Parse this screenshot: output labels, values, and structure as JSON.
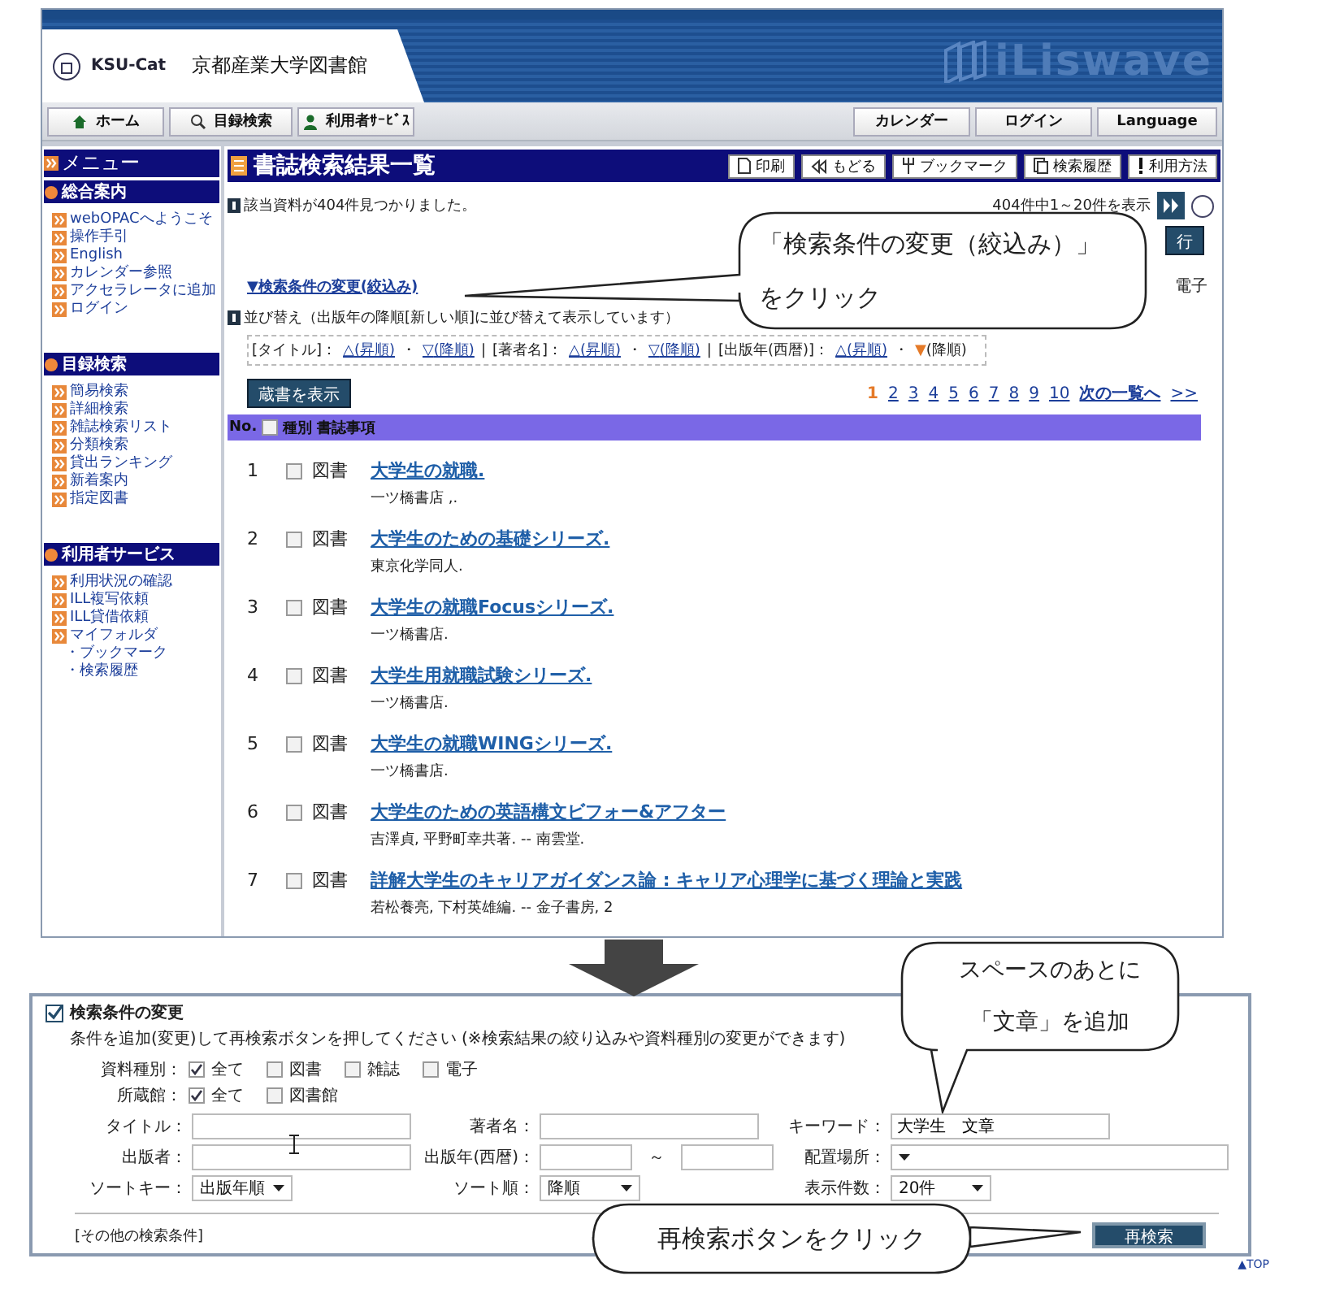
{
  "header": {
    "logo_text": "KSU-Cat",
    "library_name": "京都産業大学図書館",
    "brand": "iLiswave"
  },
  "nav": {
    "left": [
      "ホーム",
      "目録検索",
      "利用者ｻｰﾋﾞｽ"
    ],
    "right": [
      "カレンダー",
      "ログイン",
      "Language"
    ]
  },
  "sidebar": {
    "title": "メニュー",
    "sections": [
      {
        "title": "総合案内",
        "items": [
          {
            "label": "webOPACへようこそ"
          },
          {
            "label": "操作手引"
          },
          {
            "label": "English"
          },
          {
            "label": "カレンダー参照"
          },
          {
            "label": "アクセラレータに追加"
          },
          {
            "label": "ログイン"
          }
        ]
      },
      {
        "title": "目録検索",
        "items": [
          {
            "label": "簡易検索"
          },
          {
            "label": "詳細検索"
          },
          {
            "label": "雑誌検索リスト"
          },
          {
            "label": "分類検索"
          },
          {
            "label": "貸出ランキング"
          },
          {
            "label": "新着案内"
          },
          {
            "label": "指定図書"
          }
        ]
      },
      {
        "title": "利用者サービス",
        "items": [
          {
            "label": "利用状況の確認"
          },
          {
            "label": "ILL複写依頼"
          },
          {
            "label": "ILL貸借依頼"
          },
          {
            "label": "マイフォルダ",
            "children": [
              {
                "label": "・ブックマーク"
              },
              {
                "label": "・検索履歴"
              }
            ]
          }
        ]
      }
    ]
  },
  "main": {
    "title": "書誌検索結果一覧",
    "toolbar": [
      "印刷",
      "もどる",
      "ブックマーク",
      "検索履歴",
      "利用方法"
    ],
    "result_message": "該当資料が404件見つかりました。",
    "range": "404件中1～20件を表示",
    "covered_button": "行",
    "covered_label": "電子",
    "refine_link": "▼検索条件の変更(絞込み)",
    "sort_note": "並び替え（出版年の降順[新しい順]に並び替えて表示しています）",
    "option_separator": "・",
    "group_separator": "|",
    "sort_groups": [
      {
        "label": "[タイトル]：",
        "options": [
          {
            "arrow": "△",
            "label": "(昇順)",
            "selected": false
          },
          {
            "arrow": "▽",
            "label": "(降順)",
            "selected": false
          }
        ]
      },
      {
        "label": "[著者名]：",
        "options": [
          {
            "arrow": "△",
            "label": "(昇順)",
            "selected": false
          },
          {
            "arrow": "▽",
            "label": "(降順)",
            "selected": false
          }
        ]
      },
      {
        "label": "[出版年(西暦)]：",
        "options": [
          {
            "arrow": "△",
            "label": "(昇順)",
            "selected": false
          },
          {
            "arrow": "▼",
            "label": "(降順)",
            "selected": true
          }
        ]
      }
    ],
    "holdings_button": "蔵書を表示",
    "pages": [
      {
        "label": "1",
        "selected": true
      },
      {
        "label": "2",
        "selected": false
      },
      {
        "label": "3",
        "selected": false
      },
      {
        "label": "4",
        "selected": false
      },
      {
        "label": "5",
        "selected": false
      },
      {
        "label": "6",
        "selected": false
      },
      {
        "label": "7",
        "selected": false
      },
      {
        "label": "8",
        "selected": false
      },
      {
        "label": "9",
        "selected": false
      },
      {
        "label": "10",
        "selected": false
      }
    ],
    "next": "次の一覧へ",
    "last": ">>",
    "table": {
      "columns": [
        "No.",
        "種別",
        "書誌事項"
      ],
      "all_checked": false,
      "rows": [
        {
          "no": "1",
          "checked": false,
          "type": "図書",
          "title": "大学生の就職.",
          "detail": "一ツ橋書店 ,."
        },
        {
          "no": "2",
          "checked": false,
          "type": "図書",
          "title": "大学生のための基礎シリーズ.",
          "detail": "東京化学同人."
        },
        {
          "no": "3",
          "checked": false,
          "type": "図書",
          "title": "大学生の就職Focusシリーズ.",
          "detail": "一ツ橋書店."
        },
        {
          "no": "4",
          "checked": false,
          "type": "図書",
          "title": "大学生用就職試験シリーズ.",
          "detail": "一ツ橋書店."
        },
        {
          "no": "5",
          "checked": false,
          "type": "図書",
          "title": "大学生の就職WINGシリーズ.",
          "detail": "一ツ橋書店."
        },
        {
          "no": "6",
          "checked": false,
          "type": "図書",
          "title": "大学生のための英語構文ビフォー&アフター",
          "detail": "吉澤貞, 平野町幸共著. -- 南雲堂."
        },
        {
          "no": "7",
          "checked": false,
          "type": "図書",
          "title": "詳解大学生のキャリアガイダンス論 : キャリア心理学に基づく理論と実践",
          "detail": "若松養亮, 下村英雄編. -- 金子書房, 2"
        }
      ]
    }
  },
  "refine_form": {
    "title": "検索条件の変更",
    "instructions": "条件を追加(変更)して再検索ボタンを押してください (※検索結果の絞り込みや資料種別の変更ができます)",
    "checkbox_rows": [
      {
        "label": "資料種別：",
        "options": [
          {
            "label": "全て",
            "checked": true
          },
          {
            "label": "図書",
            "checked": false
          },
          {
            "label": "雑誌",
            "checked": false
          },
          {
            "label": "電子",
            "checked": false
          }
        ]
      },
      {
        "label": "所蔵館：",
        "options": [
          {
            "label": "全て",
            "checked": true
          },
          {
            "label": "図書館",
            "checked": false
          }
        ]
      }
    ],
    "field_rows": [
      [
        {
          "kind": "text",
          "label": "タイトル："
        },
        {
          "kind": "text",
          "label": "著者名："
        },
        {
          "kind": "text",
          "label": "キーワード：",
          "value": "大学生　文章"
        }
      ],
      [
        {
          "kind": "text",
          "label": "出版者："
        },
        {
          "kind": "range",
          "label": "出版年(西暦)：",
          "separator": "～"
        },
        {
          "kind": "select",
          "label": "配置場所："
        }
      ],
      [
        {
          "kind": "select",
          "label": "ソートキー：",
          "value": "出版年順"
        },
        {
          "kind": "select",
          "label": "ソート順：",
          "value": "降順"
        },
        {
          "kind": "select",
          "label": "表示件数：",
          "value": "20件"
        }
      ]
    ],
    "other_conditions": "[その他の検索条件]",
    "submit": "再検索",
    "top_link": "▲TOP"
  },
  "callouts": [
    {
      "lines": [
        "「検索条件の変更（絞込み）」",
        "をクリック"
      ]
    },
    {
      "lines": [
        "スペースのあとに",
        "「文章」を追加"
      ]
    },
    {
      "lines": [
        "再検索ボタンをクリック"
      ]
    }
  ]
}
